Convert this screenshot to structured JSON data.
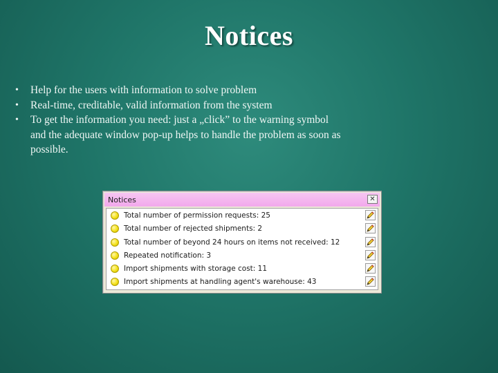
{
  "slide": {
    "title": "Notices",
    "bullets": [
      "Help for the users  with information to solve problem",
      "Real-time, creditable, valid information from the system",
      "To get the information you need: just a „click” to the warning symbol and the adequate window pop-up helps to handle the problem as soon as possible."
    ]
  },
  "window": {
    "title": "Notices",
    "close_label": "✕",
    "items": [
      {
        "label": "Total number of permission requests: 25"
      },
      {
        "label": "Total number of rejected shipments: 2"
      },
      {
        "label": "Total number of beyond 24 hours on items not received: 12"
      },
      {
        "label": "Repeated notification: 3"
      },
      {
        "label": "Import shipments with storage cost: 11"
      },
      {
        "label": "Import shipments at handling agent's warehouse: 43"
      }
    ]
  },
  "colors": {
    "background": "#1f7568",
    "window_titlebar": "#f2a8ec",
    "bulb": "#f4e11a"
  },
  "icons": {
    "bullet": "bullet-dot",
    "item_status": "yellow-bulb-icon",
    "item_action": "pencil-edit-icon",
    "close": "close-icon"
  }
}
